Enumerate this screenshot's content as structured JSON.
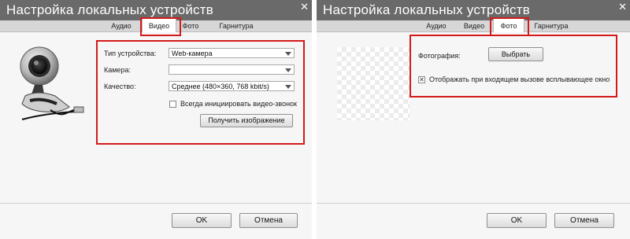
{
  "left": {
    "title": "Настройка локальных устройств",
    "tabs": [
      "Аудио",
      "Видео",
      "Фото",
      "Гарнитура"
    ],
    "active_tab": "Видео",
    "device_type_label": "Тип устройства:",
    "device_type_value": "Web-камера",
    "camera_label": "Камера:",
    "camera_value": "",
    "quality_label": "Качество:",
    "quality_value": "Среднее (480×360, 768 kbit/s)",
    "always_start_video_label": "Всегда инициировать видео-звонок",
    "always_start_video_checked": false,
    "get_image_button": "Получить изображение",
    "ok_button": "OK",
    "cancel_button": "Отмена"
  },
  "right": {
    "title": "Настройка локальных устройств",
    "tabs": [
      "Аудио",
      "Видео",
      "Фото",
      "Гарнитура"
    ],
    "active_tab": "Фото",
    "photo_label": "Фотография:",
    "choose_button": "Выбрать",
    "popup_label": "Отображать при входящем вызове всплывающее окно",
    "popup_checked": true,
    "ok_button": "OK",
    "cancel_button": "Отмена"
  },
  "colors": {
    "titlebar": "#6a6a6a",
    "tabbar": "#d7d7d7",
    "highlight": "#d31a1a",
    "panel_bg": "#f6f6f6"
  }
}
